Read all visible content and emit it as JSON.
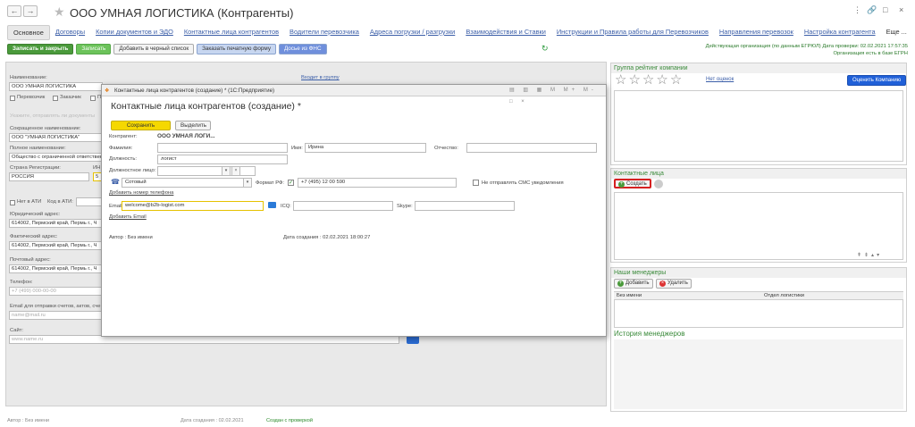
{
  "header": {
    "title": "ООО УМНАЯ ЛОГИСТИКА (Контрагенты)",
    "back": "←",
    "forward": "→",
    "controls": [
      "⋮",
      "🔗",
      "□",
      "×"
    ]
  },
  "tabs": [
    "Основное",
    "Договоры",
    "Копии документов и ЭДО",
    "Контактные лица контрагентов",
    "Водители перевозчика",
    "Адреса погрузки / разгрузки",
    "Взаимодействия и Ставки",
    "Инструкции и Правила работы для Перевозчиков",
    "Направления перевозок",
    "Настройка контрагента"
  ],
  "tab_more": "Еще ...",
  "toolbar": {
    "save_close": "Записать и закрыть",
    "save": "Записать",
    "blacklist": "Добавить в черный список",
    "print_form": "Заказать печатную форму",
    "fns": "Досье из ФНС"
  },
  "status": {
    "line1": "Действующая организация (по данным ЕГРЮЛ) Дата проверки: 02.02.2021 17:57:35",
    "line2": "Организация есть в базе ЕГРН"
  },
  "left_form": {
    "group_link": "Входит в группу",
    "name_label": "Наименование:",
    "name_value": "ООО УМНАЯ ЛОГИСТИКА",
    "carrier": "Перевозчик",
    "customer": "Заказчик",
    "p_cut": "П",
    "hint": "Укажите, отправлять ли документы",
    "short_label": "Сокращенное наименование:",
    "short_value": "ООО \"УМНАЯ ЛОГИСТИКА\"",
    "full_label": "Полное наименование:",
    "full_value": "Общество с ограниченной ответственностью",
    "country_label": "Страна Регистрации:",
    "inn_label": "ИН",
    "country_value": "РОССИЯ",
    "ati_no": "Нет в АТИ",
    "ati_code": "Код в АТИ:",
    "legal_label": "Юридический адрес:",
    "legal_value": "614002, Пермский край, Пермь г., Ч",
    "actual_label": "Фактический адрес:",
    "actual_value": "614002, Пермский край, Пермь г., Ч",
    "postal_label": "Почтовый адрес:",
    "postal_value": "614002, Пермский край, Пермь г., Ч",
    "phone_label": "Телефон:",
    "phone_ph": "+7 (499) 000-00-00",
    "email_label": "Email для отправки счетов, актов, сче",
    "email_ph": "name@mail.ru",
    "site_label": "Сайт:",
    "site_ph": "www.name.ru"
  },
  "rating": {
    "title": "Группа рейтинг компании",
    "no_ratings": "Нет оценок",
    "rate_button": "Оценить Компанию"
  },
  "contacts": {
    "title": "Контактные лица",
    "create": "Создать"
  },
  "managers": {
    "title": "Наши менеджеры",
    "add": "Добавить",
    "delete": "Удалить",
    "col1": "Без имени",
    "col2": "Отдел логистики"
  },
  "history": {
    "title": "История менеджеров"
  },
  "footer": {
    "author": "Автор : Без имени",
    "created": "Дата создания : 02.02.2021",
    "checked": "Создан с проверкой"
  },
  "modal": {
    "window_title": "Контактные лица контрагентов (создание) * (1С:Предприятие)",
    "title": "Контактные лица контрагентов (создание) *",
    "save": "Сохранить",
    "select": "Выделить",
    "counterparty_label": "Контрагент:",
    "counterparty_value": "ООО УМНАЯ ЛОГИ...",
    "surname_label": "Фамилия:",
    "name_label": "Имя:",
    "name_value": "Ирина",
    "patronymic_label": "Отчество:",
    "position_label": "Должность:",
    "position_value": "логист",
    "official_label": "Должностное лицо:",
    "phone_type": "Сотовый",
    "format_label": "Формат РФ:",
    "phone_value": "+7 (495) 12 00 590",
    "no_sms": "Не отправлять СМС уведомления",
    "add_phone": "Добавить номер телефона",
    "email_label": "Email:",
    "email_value": "welcome@b2b-logist.com",
    "icq_label": "ICQ:",
    "skype_label": "Skype:",
    "add_email": "Добавить Email",
    "author": "Автор : Без имени",
    "created": "Дата создания : 02.02.2021 18:00:27"
  }
}
